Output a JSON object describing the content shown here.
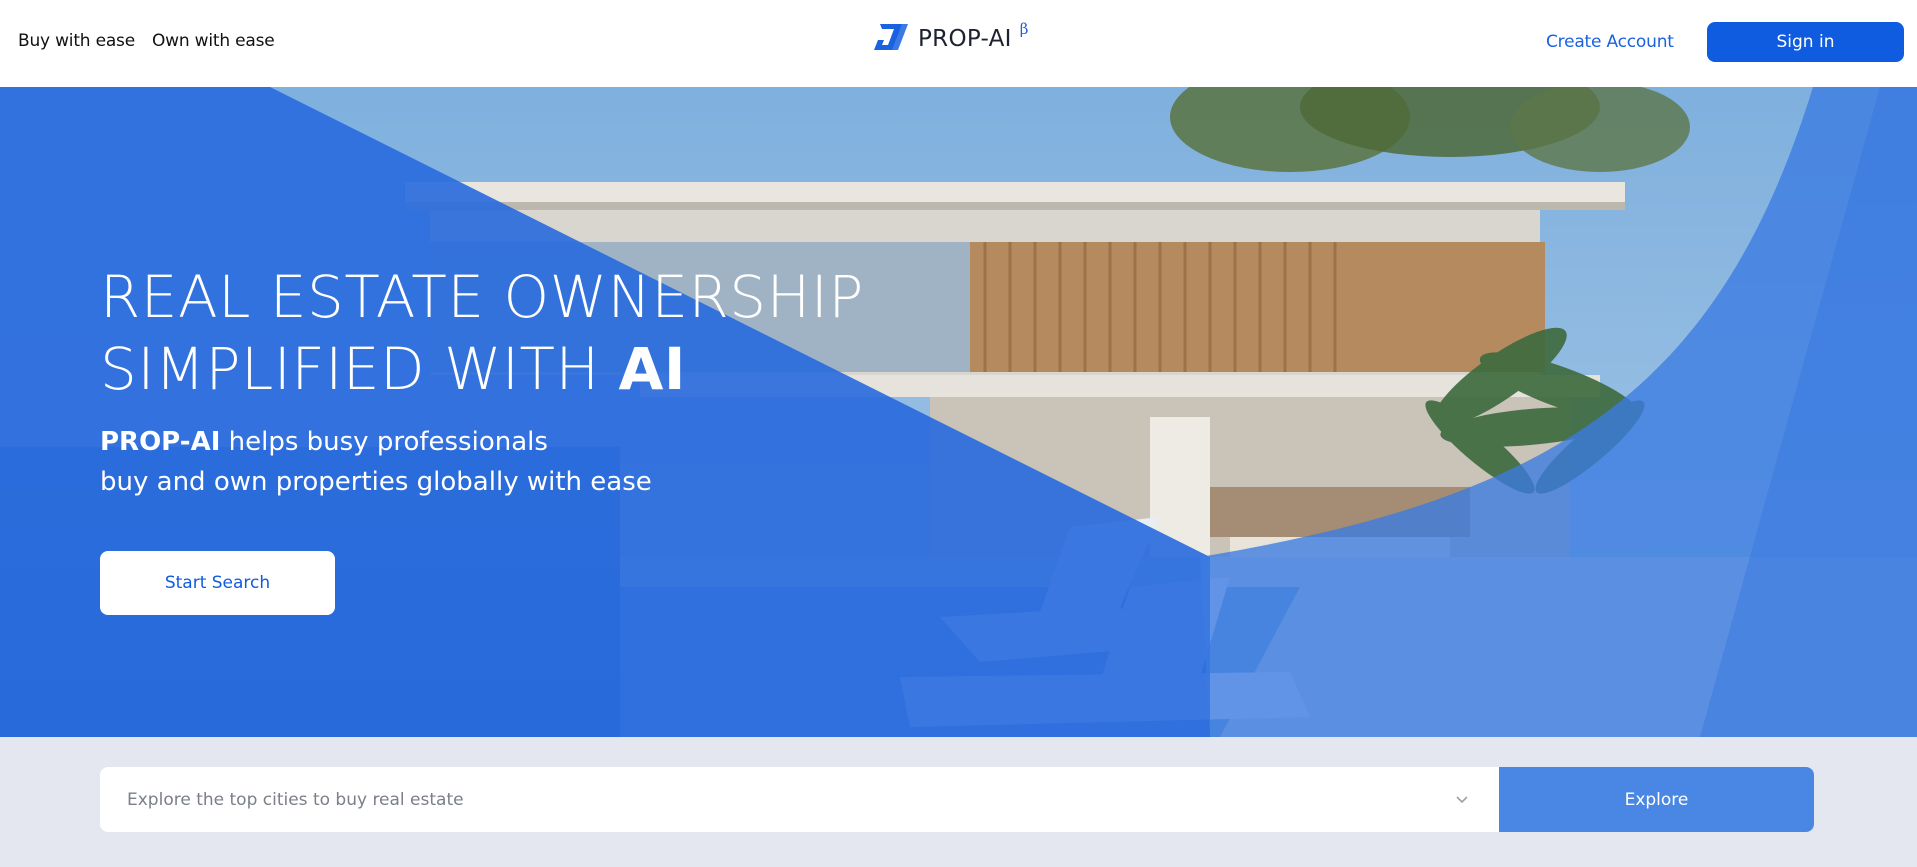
{
  "header": {
    "nav": [
      {
        "label": "Buy with ease"
      },
      {
        "label": "Own with ease"
      }
    ],
    "logo": {
      "text": "PROP-AI",
      "beta": "β"
    },
    "create_account": "Create Account",
    "sign_in": "Sign in"
  },
  "hero": {
    "title_line1": "REAL ESTATE OWNERSHIP",
    "title_line2_prefix": "SIMPLIFIED WITH ",
    "title_line2_bold": "AI",
    "subtitle_brand": "PROP-AI",
    "subtitle_line1_rest": " helps busy professionals",
    "subtitle_line2": "buy and own properties globally with ease",
    "cta": "Start Search"
  },
  "search": {
    "placeholder": "Explore the top cities to buy real estate",
    "explore": "Explore"
  },
  "colors": {
    "brand_blue": "#0f5ce0",
    "overlay_blue": "#2f6fe0",
    "explore_blue": "#4a87e4"
  }
}
